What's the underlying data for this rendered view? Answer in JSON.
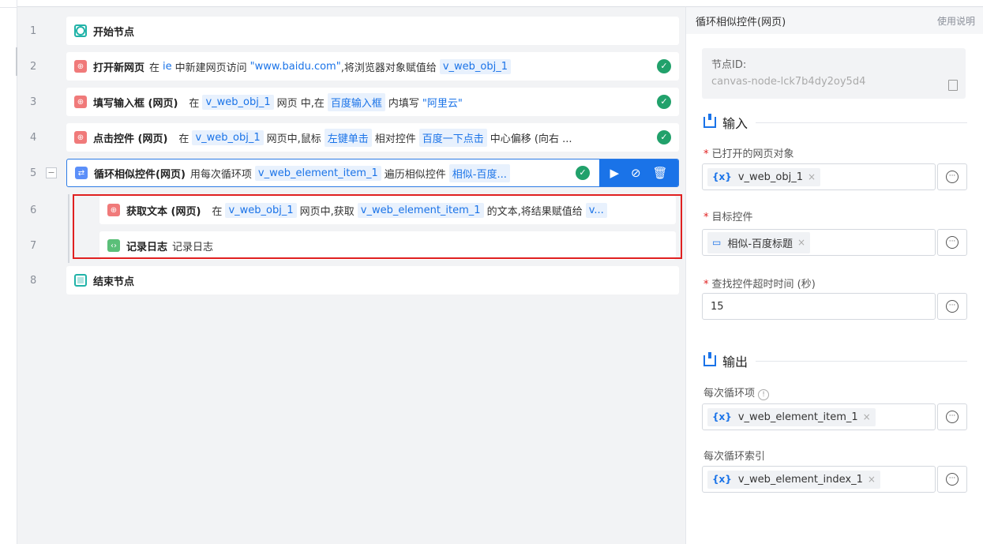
{
  "canvas": {
    "rows": [
      {
        "no": "1",
        "title": "开始节点"
      },
      {
        "no": "2",
        "title": "打开新网页",
        "p1": "在",
        "p2": "ie",
        "p3": "中新建网页访问",
        "p4": "\"www.baidu.com\"",
        "p5": ",将浏览器对象赋值给",
        "c1": "v_web_obj_1"
      },
      {
        "no": "3",
        "title": "填写输入框 (网页)",
        "p1": "在",
        "c1": "v_web_obj_1",
        "p2": "网页 中,在",
        "c2": "百度输入框",
        "p3": "内填写",
        "p4": "\"阿里云\""
      },
      {
        "no": "4",
        "title": "点击控件 (网页)",
        "p1": "在",
        "c1": "v_web_obj_1",
        "p2": "网页中,鼠标",
        "p3": "左键单击",
        "p4": "相对控件",
        "c2": "百度一下点击",
        "p5": "中心偏移 (向右 ..."
      },
      {
        "no": "5",
        "collapse": "−",
        "title": "循环相似控件(网页)",
        "p1": "用每次循环项",
        "c1": "v_web_element_item_1",
        "p2": "遍历相似控件",
        "c2": "相似-百度..."
      },
      {
        "no": "6",
        "title": "获取文本 (网页)",
        "p1": "在",
        "c1": "v_web_obj_1",
        "p2": "网页中,获取",
        "c2": "v_web_element_item_1",
        "p3": "的文本,将结果赋值给",
        "c3": "v..."
      },
      {
        "no": "7",
        "title": "记录日志",
        "p1": "记录日志"
      },
      {
        "no": "8",
        "title": "结束节点"
      }
    ]
  },
  "panel": {
    "title": "循环相似控件(网页)",
    "help": "使用说明",
    "node_id_label": "节点ID:",
    "node_id_value": "canvas-node-lck7b4dy2oy5d4",
    "input_section": "输入",
    "output_section": "输出",
    "fields": {
      "web_obj_label": "已打开的网页对象",
      "web_obj_value": "v_web_obj_1",
      "target_label": "目标控件",
      "target_value": "相似-百度标题",
      "timeout_label": "查找控件超时时间 (秒)",
      "timeout_value": "15",
      "item_label": "每次循环项",
      "item_value": "v_web_element_item_1",
      "index_label": "每次循环索引",
      "index_value": "v_web_element_index_1"
    },
    "var_icon": "{x}",
    "remove_icon": "×",
    "more_icon": "···"
  }
}
